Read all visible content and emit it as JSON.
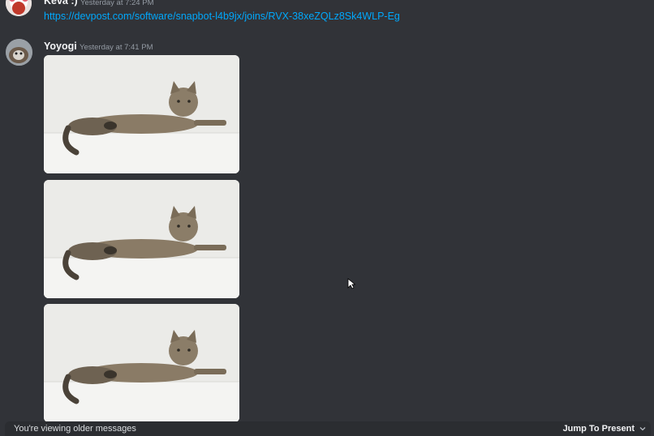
{
  "messages": [
    {
      "author": "Keva :)",
      "timestamp": "Yesterday at 7:24 PM",
      "link": "https://devpost.com/software/snapbot-l4b9jx/joins/RVX-38xeZQLz8Sk4WLP-Eg",
      "avatar_icon": "pink-character-avatar"
    },
    {
      "author": "Yoyogi",
      "timestamp": "Yesterday at 7:41 PM",
      "avatar_icon": "cat-avatar",
      "attachments": [
        "tabby-cat-photo",
        "tabby-cat-photo",
        "tabby-cat-photo"
      ]
    }
  ],
  "older_bar": {
    "text": "You're viewing older messages",
    "jump_label": "Jump To Present"
  },
  "colors": {
    "background": "#313338",
    "bar": "#2b2d31",
    "link": "#00a8fc",
    "timestamp": "#949ba4"
  }
}
